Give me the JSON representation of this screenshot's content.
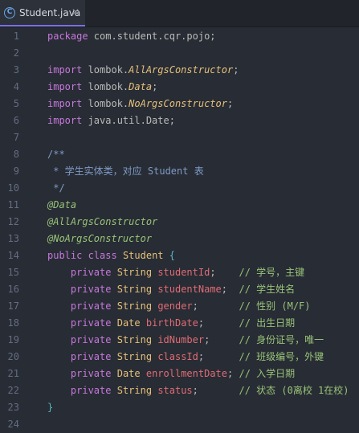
{
  "tab": {
    "label": "Student.java",
    "icon": "class-icon",
    "close": "✕"
  },
  "lines": [
    {
      "n": "1",
      "tokens": [
        [
          "package",
          "kw"
        ],
        [
          " com.student.cqr.pojo;",
          "pl"
        ]
      ]
    },
    {
      "n": "2",
      "tokens": []
    },
    {
      "n": "3",
      "tokens": [
        [
          "import",
          "kw"
        ],
        [
          " lombok.",
          "pl"
        ],
        [
          "AllArgsConstructor",
          "it"
        ],
        [
          ";",
          "pl"
        ]
      ]
    },
    {
      "n": "4",
      "tokens": [
        [
          "import",
          "kw"
        ],
        [
          " lombok.",
          "pl"
        ],
        [
          "Data",
          "it"
        ],
        [
          ";",
          "pl"
        ]
      ]
    },
    {
      "n": "5",
      "tokens": [
        [
          "import",
          "kw"
        ],
        [
          " lombok.",
          "pl"
        ],
        [
          "NoArgsConstructor",
          "it"
        ],
        [
          ";",
          "pl"
        ]
      ]
    },
    {
      "n": "6",
      "tokens": [
        [
          "import",
          "kw"
        ],
        [
          " java.util.Date;",
          "pl"
        ]
      ]
    },
    {
      "n": "7",
      "tokens": []
    },
    {
      "n": "8",
      "tokens": [
        [
          "/**",
          "doc"
        ]
      ]
    },
    {
      "n": "9",
      "tokens": [
        [
          " * 学生实体类，对应 Student 表",
          "doc"
        ]
      ]
    },
    {
      "n": "10",
      "tokens": [
        [
          " */",
          "doc"
        ]
      ]
    },
    {
      "n": "11",
      "tokens": [
        [
          "@Data",
          "an"
        ]
      ]
    },
    {
      "n": "12",
      "tokens": [
        [
          "@AllArgsConstructor",
          "an"
        ]
      ]
    },
    {
      "n": "13",
      "tokens": [
        [
          "@NoArgsConstructor",
          "an"
        ]
      ]
    },
    {
      "n": "14",
      "tokens": [
        [
          "public",
          "kw"
        ],
        [
          " ",
          "pl"
        ],
        [
          "class",
          "kw"
        ],
        [
          " ",
          "pl"
        ],
        [
          "Student",
          "cls"
        ],
        [
          " {",
          "br"
        ]
      ]
    },
    {
      "n": "15",
      "tokens": [
        [
          "    private",
          "kw"
        ],
        [
          " ",
          "pl"
        ],
        [
          "String",
          "ty"
        ],
        [
          " ",
          "pl"
        ],
        [
          "studentId",
          "fd"
        ],
        [
          ";",
          "pl"
        ],
        [
          "    // 学号，主键",
          "cmt"
        ]
      ]
    },
    {
      "n": "16",
      "tokens": [
        [
          "    private",
          "kw"
        ],
        [
          " ",
          "pl"
        ],
        [
          "String",
          "ty"
        ],
        [
          " ",
          "pl"
        ],
        [
          "studentName",
          "fd"
        ],
        [
          ";",
          "pl"
        ],
        [
          "  // 学生姓名",
          "cmt"
        ]
      ]
    },
    {
      "n": "17",
      "tokens": [
        [
          "    private",
          "kw"
        ],
        [
          " ",
          "pl"
        ],
        [
          "String",
          "ty"
        ],
        [
          " ",
          "pl"
        ],
        [
          "gender",
          "fd"
        ],
        [
          ";",
          "pl"
        ],
        [
          "       // 性别 (M/F)",
          "cmt"
        ]
      ]
    },
    {
      "n": "18",
      "tokens": [
        [
          "    private",
          "kw"
        ],
        [
          " ",
          "pl"
        ],
        [
          "Date",
          "ty"
        ],
        [
          " ",
          "pl"
        ],
        [
          "birthDate",
          "fd"
        ],
        [
          ";",
          "pl"
        ],
        [
          "      // 出生日期",
          "cmt"
        ]
      ]
    },
    {
      "n": "19",
      "tokens": [
        [
          "    private",
          "kw"
        ],
        [
          " ",
          "pl"
        ],
        [
          "String",
          "ty"
        ],
        [
          " ",
          "pl"
        ],
        [
          "idNumber",
          "fd"
        ],
        [
          ";",
          "pl"
        ],
        [
          "     // 身份证号，唯一",
          "cmt"
        ]
      ]
    },
    {
      "n": "20",
      "tokens": [
        [
          "    private",
          "kw"
        ],
        [
          " ",
          "pl"
        ],
        [
          "String",
          "ty"
        ],
        [
          " ",
          "pl"
        ],
        [
          "classId",
          "fd"
        ],
        [
          ";",
          "pl"
        ],
        [
          "      // 班级编号，外键",
          "cmt"
        ]
      ]
    },
    {
      "n": "21",
      "tokens": [
        [
          "    private",
          "kw"
        ],
        [
          " ",
          "pl"
        ],
        [
          "Date",
          "ty"
        ],
        [
          " ",
          "pl"
        ],
        [
          "enrollmentDate",
          "fd"
        ],
        [
          ";",
          "pl"
        ],
        [
          " // 入学日期",
          "cmt"
        ]
      ]
    },
    {
      "n": "22",
      "tokens": [
        [
          "    private",
          "kw"
        ],
        [
          " ",
          "pl"
        ],
        [
          "String",
          "ty"
        ],
        [
          " ",
          "pl"
        ],
        [
          "status",
          "fd"
        ],
        [
          ";",
          "pl"
        ],
        [
          "       // 状态 (0离校 1在校)",
          "cmt"
        ]
      ]
    },
    {
      "n": "23",
      "tokens": [
        [
          "}",
          "br"
        ]
      ]
    },
    {
      "n": "24",
      "tokens": []
    }
  ]
}
